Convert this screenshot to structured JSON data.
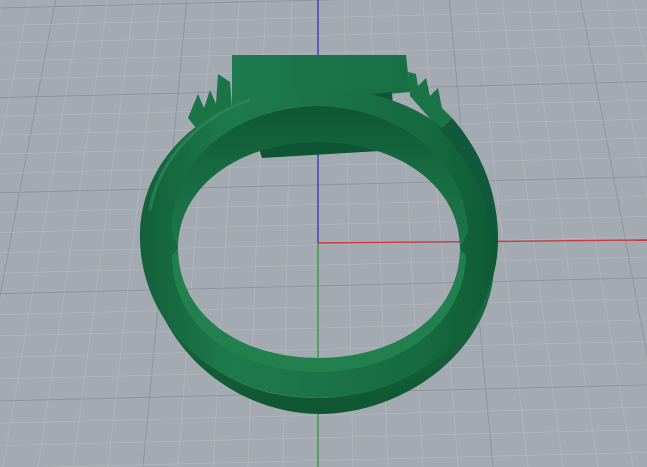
{
  "viewport": {
    "view_name": "",
    "background_color": "#a4aab1",
    "grid_minor_color": "#b4b9bf",
    "grid_major_color": "#8d939a"
  },
  "axes": {
    "x_axis_color": "#c83c3c",
    "y_axis_color": "#3a9a3a",
    "z_axis_color": "#3b3bbf"
  },
  "model": {
    "object": "ring",
    "shank_color": "#1c7448",
    "inner_color": "#15673e",
    "shadow_color": "#0c4b2b",
    "highlight_color": "#2f8a5a"
  }
}
